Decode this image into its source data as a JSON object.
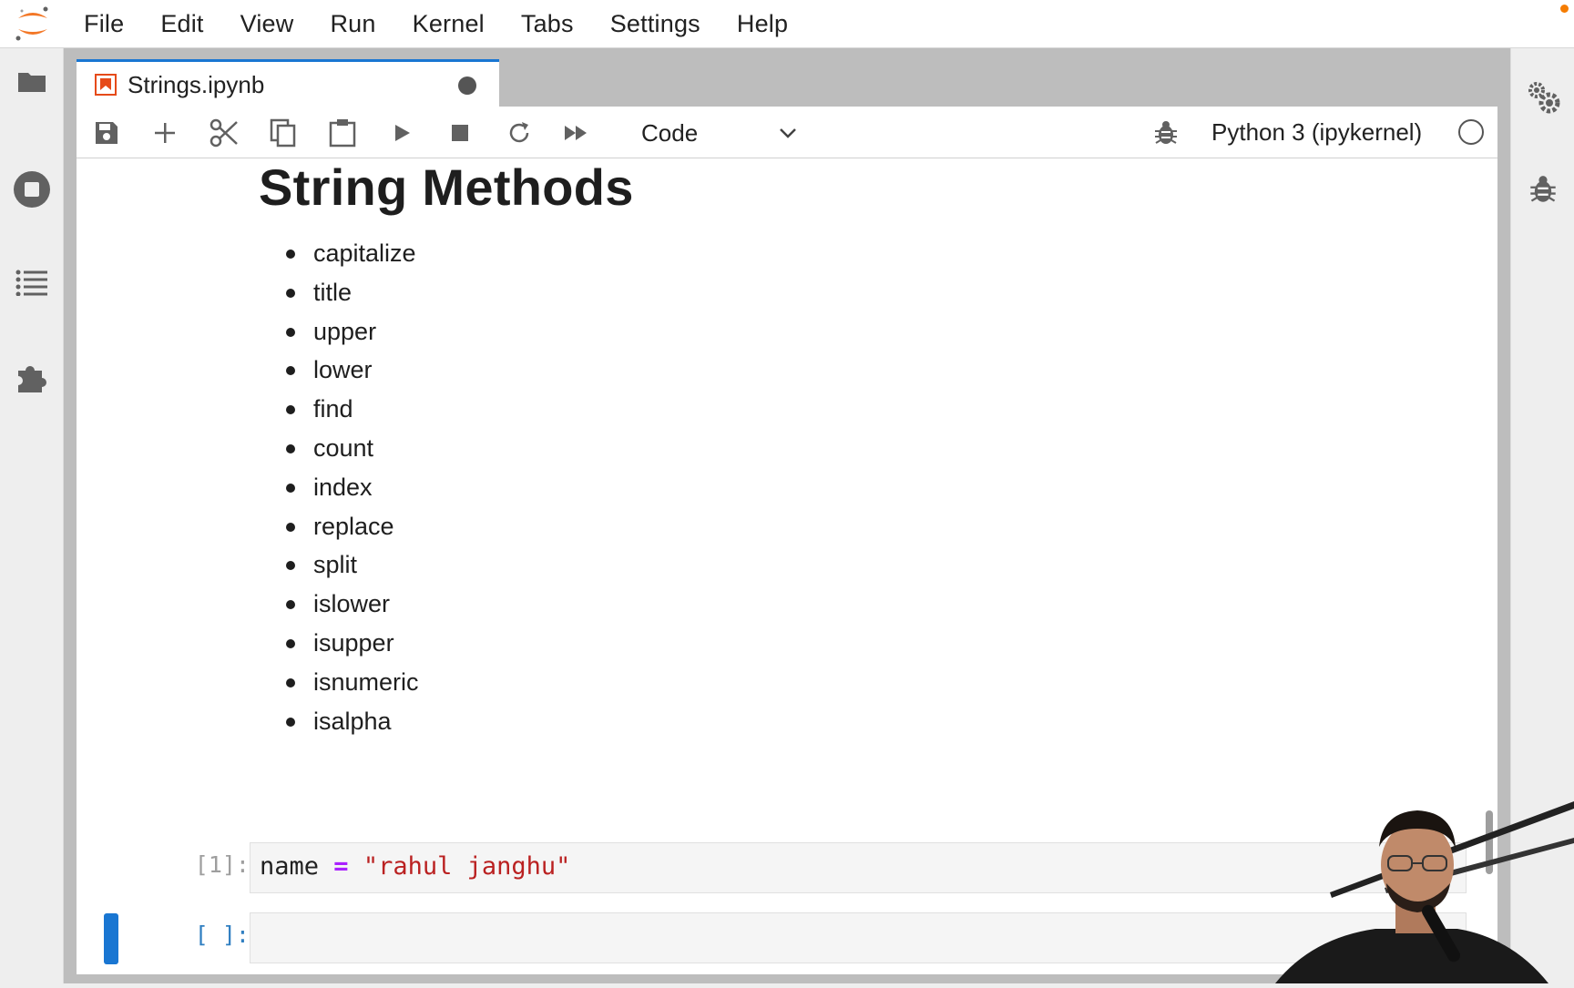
{
  "menu": {
    "items": [
      "File",
      "Edit",
      "View",
      "Run",
      "Kernel",
      "Tabs",
      "Settings",
      "Help"
    ]
  },
  "left_rail": {
    "icons": [
      "folder-icon",
      "running-terminals-icon",
      "table-of-contents-icon",
      "extensions-icon"
    ]
  },
  "right_rail": {
    "icons": [
      "property-inspector-icon",
      "debugger-icon"
    ]
  },
  "tab": {
    "title": "Strings.ipynb",
    "dirty": true
  },
  "toolbar": {
    "buttons": [
      "save-icon",
      "add-cell-icon",
      "cut-icon",
      "copy-icon",
      "paste-icon",
      "run-icon",
      "stop-icon",
      "restart-icon",
      "run-all-icon"
    ],
    "cell_type": "Code",
    "kernel_name": "Python 3 (ipykernel)",
    "kernel_status": "idle"
  },
  "notebook": {
    "markdown_title": "String Methods",
    "markdown_items": [
      "capitalize",
      "title",
      "upper",
      "lower",
      "find",
      "count",
      "index",
      "replace",
      "split",
      "islower",
      "isupper",
      "isnumeric",
      "isalpha"
    ],
    "cells": [
      {
        "prompt": "[1]:",
        "var": "name",
        "op": "=",
        "value": "\"rahul janghu\""
      },
      {
        "prompt": "[ ]:",
        "code": ""
      },
      {
        "prompt": "[ ]:",
        "code": ""
      }
    ]
  },
  "colors": {
    "accent": "#1976d2",
    "logo_orange": "#f37726",
    "string": "#ba2121",
    "operator": "#aa22ff"
  }
}
